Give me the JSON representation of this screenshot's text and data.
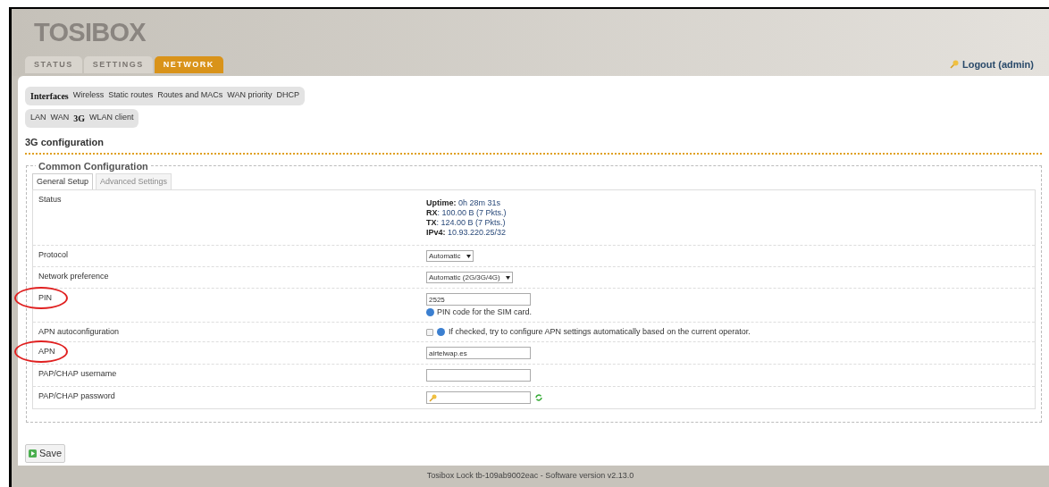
{
  "logo": "TOSIBOX",
  "tabs": [
    {
      "label": "STATUS",
      "selected": false
    },
    {
      "label": "SETTINGS",
      "selected": false
    },
    {
      "label": "NETWORK",
      "selected": true
    }
  ],
  "logout": "Logout (admin)",
  "submenu": [
    {
      "label": "Interfaces",
      "selected": true
    },
    {
      "label": "Wireless",
      "selected": false
    },
    {
      "label": "Static routes",
      "selected": false
    },
    {
      "label": "Routes and MACs",
      "selected": false
    },
    {
      "label": "WAN priority",
      "selected": false
    },
    {
      "label": "DHCP",
      "selected": false
    }
  ],
  "interfaces": [
    {
      "label": "LAN",
      "selected": false
    },
    {
      "label": "WAN",
      "selected": false
    },
    {
      "label": "3G",
      "selected": true
    },
    {
      "label": "WLAN client",
      "selected": false
    }
  ],
  "heading": "3G configuration",
  "section": {
    "title": "Common Configuration",
    "tabs": [
      {
        "label": "General Setup",
        "selected": true
      },
      {
        "label": "Advanced Settings",
        "selected": false
      }
    ],
    "rows": [
      {
        "kind": "status",
        "label": "Status",
        "circled": false,
        "lines": [
          {
            "key": "Uptime:",
            "value": "0h 28m 31s"
          },
          {
            "key": "RX",
            "value": ": 100.00 B (7 Pkts.)"
          },
          {
            "key": "TX",
            "value": ": 124.00 B (7 Pkts.)"
          },
          {
            "key": "IPv4:",
            "value": "10.93.220.25/32"
          }
        ]
      },
      {
        "kind": "select",
        "label": "Protocol",
        "circled": false,
        "value": "Automatic"
      },
      {
        "kind": "select",
        "label": "Network preference",
        "circled": false,
        "value": "Automatic (2G/3G/4G)"
      },
      {
        "kind": "text",
        "label": "PIN",
        "circled": true,
        "value": "2525",
        "hint": "PIN code for the SIM card."
      },
      {
        "kind": "checkbox",
        "label": "APN autoconfiguration",
        "circled": false,
        "checked": false,
        "hint": "If checked, try to configure APN settings automatically based on the current operator."
      },
      {
        "kind": "text",
        "label": "APN",
        "circled": true,
        "value": "airtelwap.es"
      },
      {
        "kind": "text",
        "label": "PAP/CHAP username",
        "circled": false
      },
      {
        "kind": "password",
        "label": "PAP/CHAP password",
        "circled": false
      }
    ]
  },
  "save": "Save",
  "footer": "Tosibox Lock tb-109ab9002eac - Software version v2.13.0"
}
